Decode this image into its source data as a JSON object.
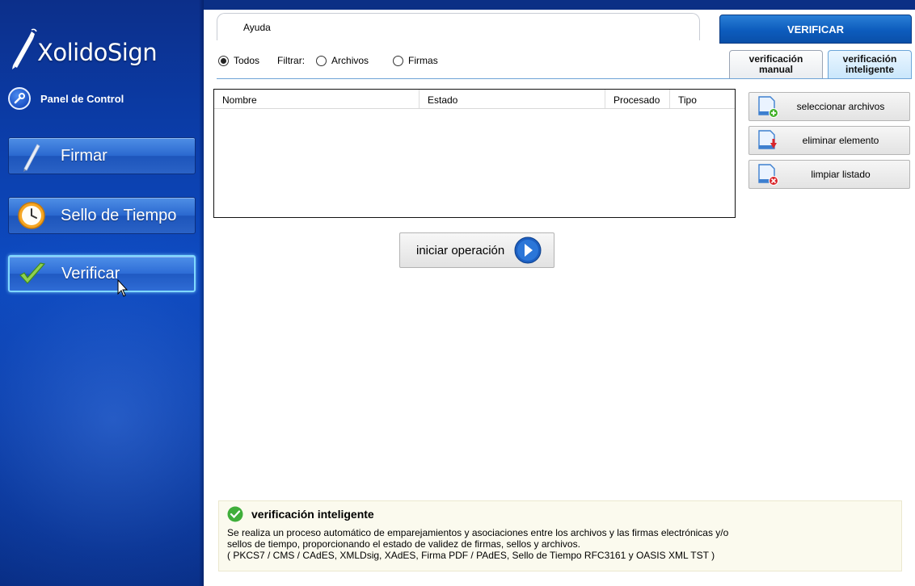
{
  "app": {
    "logo_text": "XolidoSign"
  },
  "sidebar": {
    "panel_control": "Panel de Control",
    "items": [
      {
        "label": "Firmar",
        "icon": "pen-icon"
      },
      {
        "label": "Sello de Tiempo",
        "icon": "clock-icon"
      },
      {
        "label": "Verificar",
        "icon": "checkmark-icon",
        "active": true
      }
    ]
  },
  "header": {
    "help_tab": "Ayuda",
    "section_title": "VERIFICAR"
  },
  "filter": {
    "all_label": "Todos",
    "filter_label": "Filtrar:",
    "files_label": "Archivos",
    "signatures_label": "Firmas",
    "selected": "Todos"
  },
  "mode_tabs": [
    {
      "line1": "verificación",
      "line2": "manual",
      "active": false
    },
    {
      "line1": "verificación",
      "line2": "inteligente",
      "active": true
    }
  ],
  "table": {
    "columns": [
      "Nombre",
      "Estado",
      "Procesado",
      "Tipo"
    ],
    "rows": []
  },
  "actions": {
    "select_files": "seleccionar archivos",
    "remove_item": "eliminar elemento",
    "clear_list": "limpiar listado"
  },
  "start_button": "iniciar operación",
  "info": {
    "title": "verificación inteligente",
    "line1": "Se realiza un proceso automático de emparejamientos y asociaciones entre los archivos y las firmas electrónicas y/o",
    "line2": "sellos de tiempo, proporcionando el estado de validez de firmas, sellos y archivos.",
    "line3": "( PKCS7 / CMS / CAdES, XMLDsig, XAdES, Firma PDF / PAdES, Sello de Tiempo RFC3161 y OASIS XML TST )"
  },
  "colors": {
    "sidebar_blue": "#0d4ac0",
    "header_blue": "#0d5cbd",
    "info_bg": "#fbfaee",
    "accent_green": "#3fae3a"
  }
}
